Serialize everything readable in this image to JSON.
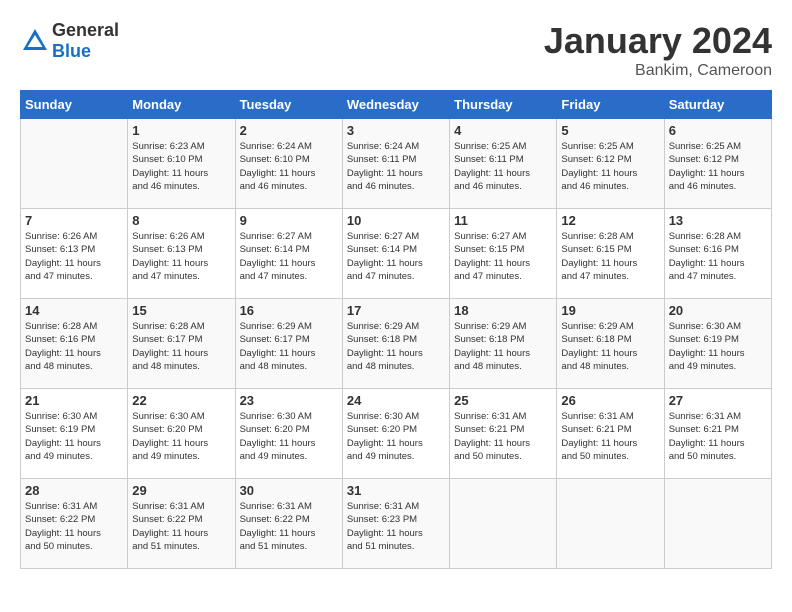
{
  "header": {
    "logo_general": "General",
    "logo_blue": "Blue",
    "month": "January 2024",
    "location": "Bankim, Cameroon"
  },
  "weekdays": [
    "Sunday",
    "Monday",
    "Tuesday",
    "Wednesday",
    "Thursday",
    "Friday",
    "Saturday"
  ],
  "weeks": [
    [
      {
        "day": "",
        "info": ""
      },
      {
        "day": "1",
        "info": "Sunrise: 6:23 AM\nSunset: 6:10 PM\nDaylight: 11 hours\nand 46 minutes."
      },
      {
        "day": "2",
        "info": "Sunrise: 6:24 AM\nSunset: 6:10 PM\nDaylight: 11 hours\nand 46 minutes."
      },
      {
        "day": "3",
        "info": "Sunrise: 6:24 AM\nSunset: 6:11 PM\nDaylight: 11 hours\nand 46 minutes."
      },
      {
        "day": "4",
        "info": "Sunrise: 6:25 AM\nSunset: 6:11 PM\nDaylight: 11 hours\nand 46 minutes."
      },
      {
        "day": "5",
        "info": "Sunrise: 6:25 AM\nSunset: 6:12 PM\nDaylight: 11 hours\nand 46 minutes."
      },
      {
        "day": "6",
        "info": "Sunrise: 6:25 AM\nSunset: 6:12 PM\nDaylight: 11 hours\nand 46 minutes."
      }
    ],
    [
      {
        "day": "7",
        "info": "Sunrise: 6:26 AM\nSunset: 6:13 PM\nDaylight: 11 hours\nand 47 minutes."
      },
      {
        "day": "8",
        "info": "Sunrise: 6:26 AM\nSunset: 6:13 PM\nDaylight: 11 hours\nand 47 minutes."
      },
      {
        "day": "9",
        "info": "Sunrise: 6:27 AM\nSunset: 6:14 PM\nDaylight: 11 hours\nand 47 minutes."
      },
      {
        "day": "10",
        "info": "Sunrise: 6:27 AM\nSunset: 6:14 PM\nDaylight: 11 hours\nand 47 minutes."
      },
      {
        "day": "11",
        "info": "Sunrise: 6:27 AM\nSunset: 6:15 PM\nDaylight: 11 hours\nand 47 minutes."
      },
      {
        "day": "12",
        "info": "Sunrise: 6:28 AM\nSunset: 6:15 PM\nDaylight: 11 hours\nand 47 minutes."
      },
      {
        "day": "13",
        "info": "Sunrise: 6:28 AM\nSunset: 6:16 PM\nDaylight: 11 hours\nand 47 minutes."
      }
    ],
    [
      {
        "day": "14",
        "info": "Sunrise: 6:28 AM\nSunset: 6:16 PM\nDaylight: 11 hours\nand 48 minutes."
      },
      {
        "day": "15",
        "info": "Sunrise: 6:28 AM\nSunset: 6:17 PM\nDaylight: 11 hours\nand 48 minutes."
      },
      {
        "day": "16",
        "info": "Sunrise: 6:29 AM\nSunset: 6:17 PM\nDaylight: 11 hours\nand 48 minutes."
      },
      {
        "day": "17",
        "info": "Sunrise: 6:29 AM\nSunset: 6:18 PM\nDaylight: 11 hours\nand 48 minutes."
      },
      {
        "day": "18",
        "info": "Sunrise: 6:29 AM\nSunset: 6:18 PM\nDaylight: 11 hours\nand 48 minutes."
      },
      {
        "day": "19",
        "info": "Sunrise: 6:29 AM\nSunset: 6:18 PM\nDaylight: 11 hours\nand 48 minutes."
      },
      {
        "day": "20",
        "info": "Sunrise: 6:30 AM\nSunset: 6:19 PM\nDaylight: 11 hours\nand 49 minutes."
      }
    ],
    [
      {
        "day": "21",
        "info": "Sunrise: 6:30 AM\nSunset: 6:19 PM\nDaylight: 11 hours\nand 49 minutes."
      },
      {
        "day": "22",
        "info": "Sunrise: 6:30 AM\nSunset: 6:20 PM\nDaylight: 11 hours\nand 49 minutes."
      },
      {
        "day": "23",
        "info": "Sunrise: 6:30 AM\nSunset: 6:20 PM\nDaylight: 11 hours\nand 49 minutes."
      },
      {
        "day": "24",
        "info": "Sunrise: 6:30 AM\nSunset: 6:20 PM\nDaylight: 11 hours\nand 49 minutes."
      },
      {
        "day": "25",
        "info": "Sunrise: 6:31 AM\nSunset: 6:21 PM\nDaylight: 11 hours\nand 50 minutes."
      },
      {
        "day": "26",
        "info": "Sunrise: 6:31 AM\nSunset: 6:21 PM\nDaylight: 11 hours\nand 50 minutes."
      },
      {
        "day": "27",
        "info": "Sunrise: 6:31 AM\nSunset: 6:21 PM\nDaylight: 11 hours\nand 50 minutes."
      }
    ],
    [
      {
        "day": "28",
        "info": "Sunrise: 6:31 AM\nSunset: 6:22 PM\nDaylight: 11 hours\nand 50 minutes."
      },
      {
        "day": "29",
        "info": "Sunrise: 6:31 AM\nSunset: 6:22 PM\nDaylight: 11 hours\nand 51 minutes."
      },
      {
        "day": "30",
        "info": "Sunrise: 6:31 AM\nSunset: 6:22 PM\nDaylight: 11 hours\nand 51 minutes."
      },
      {
        "day": "31",
        "info": "Sunrise: 6:31 AM\nSunset: 6:23 PM\nDaylight: 11 hours\nand 51 minutes."
      },
      {
        "day": "",
        "info": ""
      },
      {
        "day": "",
        "info": ""
      },
      {
        "day": "",
        "info": ""
      }
    ]
  ]
}
